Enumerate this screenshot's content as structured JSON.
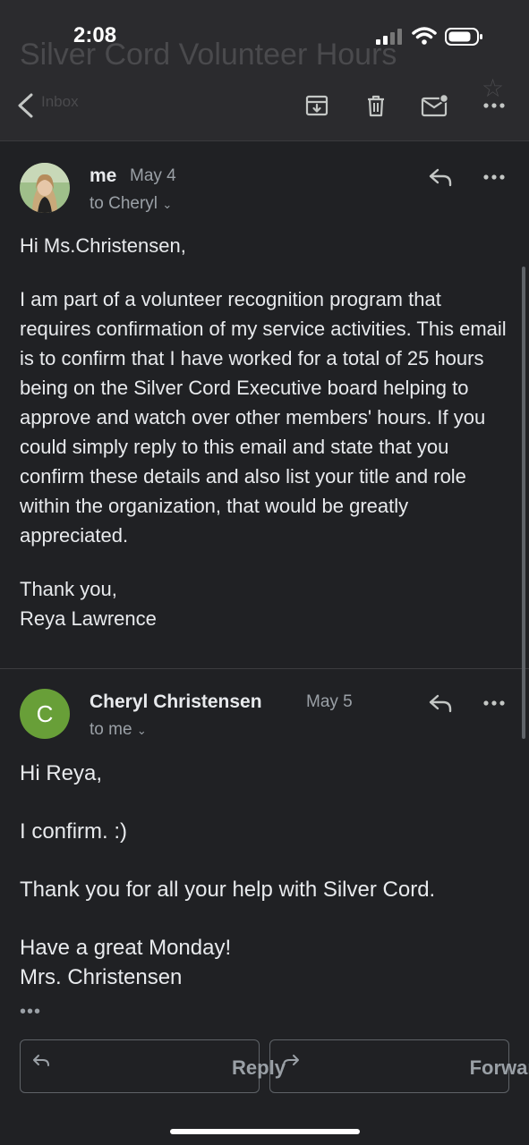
{
  "status_bar": {
    "time": "2:08"
  },
  "header": {
    "subject": "Silver Cord Volunteer Hours",
    "label": "Inbox"
  },
  "message1": {
    "sender": "me",
    "date": "May 4",
    "to": "to Cheryl",
    "avatar_icon": "profile-photo",
    "body": {
      "greeting": "Hi Ms.Christensen,",
      "paragraph": "I am part of a volunteer recognition program that requires confirmation of my service activities. This email is to confirm that I have worked for a total of 25 hours being on the Silver Cord Executive board helping to approve and watch over other members' hours. If you could simply reply to this email and state that you confirm these details and also list your title and role within the organization, that would be greatly appreciated.",
      "closing": "Thank you,",
      "signature": "Reya Lawrence"
    }
  },
  "message2": {
    "sender": "Cheryl Christensen",
    "date": "May 5",
    "to": "to me",
    "avatar_letter": "C",
    "avatar_color": "#689f38",
    "body": {
      "greeting": "Hi Reya,",
      "line1": "I confirm.  :)",
      "line2": "Thank you for all your help with Silver Cord.",
      "line3": "Have a great Monday!",
      "signature": "Mrs. Christensen"
    },
    "trimmed": "•••"
  },
  "actions": {
    "reply_label": "Reply",
    "forward_label": "Forward"
  },
  "icons": [
    "back-arrow-icon",
    "archive-icon",
    "trash-icon",
    "mark-unread-icon",
    "more-icon",
    "reply-icon",
    "forward-icon",
    "cellular-icon",
    "wifi-icon",
    "battery-icon"
  ]
}
